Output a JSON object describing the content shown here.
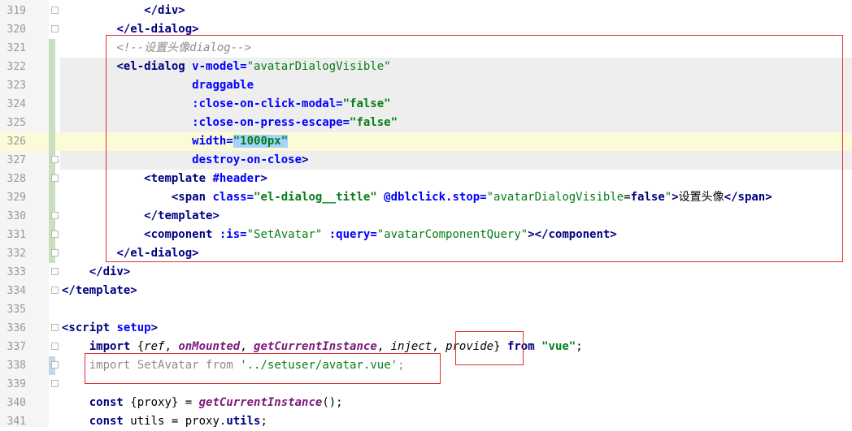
{
  "lines": [
    {
      "n": "319",
      "tokens": [
        {
          "t": "            ",
          "c": "pl"
        },
        {
          "t": "</div>",
          "c": "k"
        }
      ]
    },
    {
      "n": "320",
      "tokens": [
        {
          "t": "        ",
          "c": "pl"
        },
        {
          "t": "</el-dialog>",
          "c": "k"
        }
      ]
    },
    {
      "n": "321",
      "tokens": [
        {
          "t": "        ",
          "c": "pl"
        },
        {
          "t": "<!--设置头像dialog-->",
          "c": "c"
        }
      ]
    },
    {
      "n": "322",
      "tokens": [
        {
          "t": "        ",
          "c": "pl"
        },
        {
          "t": "<el-dialog ",
          "c": "k"
        },
        {
          "t": "v-model=",
          "c": "a"
        },
        {
          "t": "\"avatarDialogVisible\"",
          "c": "s"
        }
      ]
    },
    {
      "n": "323",
      "tokens": [
        {
          "t": "                   ",
          "c": "pl"
        },
        {
          "t": "draggable",
          "c": "a"
        }
      ]
    },
    {
      "n": "324",
      "tokens": [
        {
          "t": "                   ",
          "c": "pl"
        },
        {
          "t": ":close-on-click-modal=",
          "c": "a"
        },
        {
          "t": "\"false\"",
          "c": "sb"
        }
      ]
    },
    {
      "n": "325",
      "tokens": [
        {
          "t": "                   ",
          "c": "pl"
        },
        {
          "t": ":close-on-press-escape=",
          "c": "a"
        },
        {
          "t": "\"false\"",
          "c": "sb"
        }
      ]
    },
    {
      "n": "326",
      "tokens": [
        {
          "t": "                   ",
          "c": "pl"
        },
        {
          "t": "width=",
          "c": "a"
        },
        {
          "t": "\"1000px\"",
          "c": "sb"
        }
      ]
    },
    {
      "n": "327",
      "tokens": [
        {
          "t": "                   ",
          "c": "pl"
        },
        {
          "t": "destroy-on-close",
          "c": "a"
        },
        {
          "t": ">",
          "c": "k"
        }
      ]
    },
    {
      "n": "328",
      "tokens": [
        {
          "t": "            ",
          "c": "pl"
        },
        {
          "t": "<template ",
          "c": "k"
        },
        {
          "t": "#header",
          "c": "a"
        },
        {
          "t": ">",
          "c": "k"
        }
      ]
    },
    {
      "n": "329",
      "tokens": [
        {
          "t": "                ",
          "c": "pl"
        },
        {
          "t": "<span ",
          "c": "k"
        },
        {
          "t": "class=",
          "c": "a"
        },
        {
          "t": "\"el-dialog__title\" ",
          "c": "sb"
        },
        {
          "t": "@dblclick.stop=",
          "c": "a"
        },
        {
          "t": "\"avatarDialogVisible",
          "c": "s"
        },
        {
          "t": "=",
          "c": "pl"
        },
        {
          "t": "false",
          "c": "k"
        },
        {
          "t": "\"",
          "c": "s"
        },
        {
          "t": ">",
          "c": "k"
        },
        {
          "t": "设置头像",
          "c": "pl"
        },
        {
          "t": "</span>",
          "c": "k"
        }
      ]
    },
    {
      "n": "330",
      "tokens": [
        {
          "t": "            ",
          "c": "pl"
        },
        {
          "t": "</template>",
          "c": "k"
        }
      ]
    },
    {
      "n": "331",
      "tokens": [
        {
          "t": "            ",
          "c": "pl"
        },
        {
          "t": "<component ",
          "c": "k"
        },
        {
          "t": ":is=",
          "c": "a"
        },
        {
          "t": "\"SetAvatar\" ",
          "c": "s"
        },
        {
          "t": ":query=",
          "c": "a"
        },
        {
          "t": "\"avatarComponentQuery\"",
          "c": "s"
        },
        {
          "t": "></component>",
          "c": "k"
        }
      ]
    },
    {
      "n": "332",
      "tokens": [
        {
          "t": "        ",
          "c": "pl"
        },
        {
          "t": "</el-dialog>",
          "c": "k"
        }
      ]
    },
    {
      "n": "333",
      "tokens": [
        {
          "t": "    ",
          "c": "pl"
        },
        {
          "t": "</div>",
          "c": "k"
        }
      ]
    },
    {
      "n": "334",
      "tokens": [
        {
          "t": "</template>",
          "c": "k"
        }
      ]
    },
    {
      "n": "335",
      "tokens": []
    },
    {
      "n": "336",
      "tokens": [
        {
          "t": "<script ",
          "c": "k"
        },
        {
          "t": "setup",
          "c": "a"
        },
        {
          "t": ">",
          "c": "k"
        }
      ]
    },
    {
      "n": "337",
      "tokens": [
        {
          "t": "    ",
          "c": "pl"
        },
        {
          "t": "import ",
          "c": "k"
        },
        {
          "t": "{",
          "c": "pl"
        },
        {
          "t": "ref",
          "c": "im"
        },
        {
          "t": ", ",
          "c": "pl"
        },
        {
          "t": "onMounted",
          "c": "fn"
        },
        {
          "t": ", ",
          "c": "pl"
        },
        {
          "t": "getCurrentInstance",
          "c": "fn"
        },
        {
          "t": ", ",
          "c": "pl"
        },
        {
          "t": "inject",
          "c": "im"
        },
        {
          "t": ", ",
          "c": "pl"
        },
        {
          "t": "provide",
          "c": "im"
        },
        {
          "t": "} ",
          "c": "pl"
        },
        {
          "t": "from ",
          "c": "k"
        },
        {
          "t": "\"vue\"",
          "c": "sb"
        },
        {
          "t": ";",
          "c": "pl"
        }
      ]
    },
    {
      "n": "338",
      "tokens": [
        {
          "t": "    ",
          "c": "pl"
        },
        {
          "t": "import ",
          "c": "gr"
        },
        {
          "t": "SetAvatar ",
          "c": "gr"
        },
        {
          "t": "from ",
          "c": "gr"
        },
        {
          "t": "'../setuser/avatar.vue'",
          "c": "s"
        },
        {
          "t": ";",
          "c": "gr"
        }
      ]
    },
    {
      "n": "339",
      "tokens": []
    },
    {
      "n": "340",
      "tokens": [
        {
          "t": "    ",
          "c": "pl"
        },
        {
          "t": "const ",
          "c": "k"
        },
        {
          "t": "{proxy} = ",
          "c": "pl"
        },
        {
          "t": "getCurrentInstance",
          "c": "fn"
        },
        {
          "t": "();",
          "c": "pl"
        }
      ]
    },
    {
      "n": "341",
      "tokens": [
        {
          "t": "    ",
          "c": "pl"
        },
        {
          "t": "const ",
          "c": "k"
        },
        {
          "t": "utils = proxy.",
          "c": "pl"
        },
        {
          "t": "utils",
          "c": "k"
        },
        {
          "t": ";",
          "c": "pl"
        }
      ]
    }
  ]
}
